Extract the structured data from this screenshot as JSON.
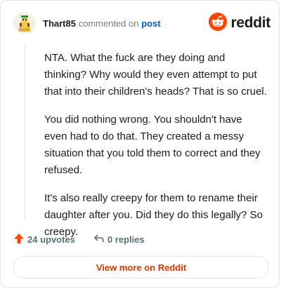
{
  "header": {
    "username": "Thart85",
    "action_text": "commented on",
    "post_link": "post",
    "brand": "reddit"
  },
  "comment": {
    "paragraphs": [
      "NTA. What the fuck are they doing and thinking? Why would they even attempt to put that into their children's heads? That is so cruel.",
      "You did nothing wrong. You shouldn't have even had to do that. They created a messy situation that you told them to correct and they refused.",
      "It's also really creepy for them to rename their daughter after you. Did they do this legally? So creepy."
    ]
  },
  "actions": {
    "upvotes": "24 upvotes",
    "replies": "0 replies"
  },
  "footer": {
    "view_more": "View more on Reddit"
  },
  "colors": {
    "accent": "#d93a00",
    "brand_orange": "#ff4500",
    "link": "#0a59b8"
  },
  "icons": [
    "avatar",
    "reddit-logo-icon",
    "upvote-arrow-icon",
    "reply-icon"
  ]
}
